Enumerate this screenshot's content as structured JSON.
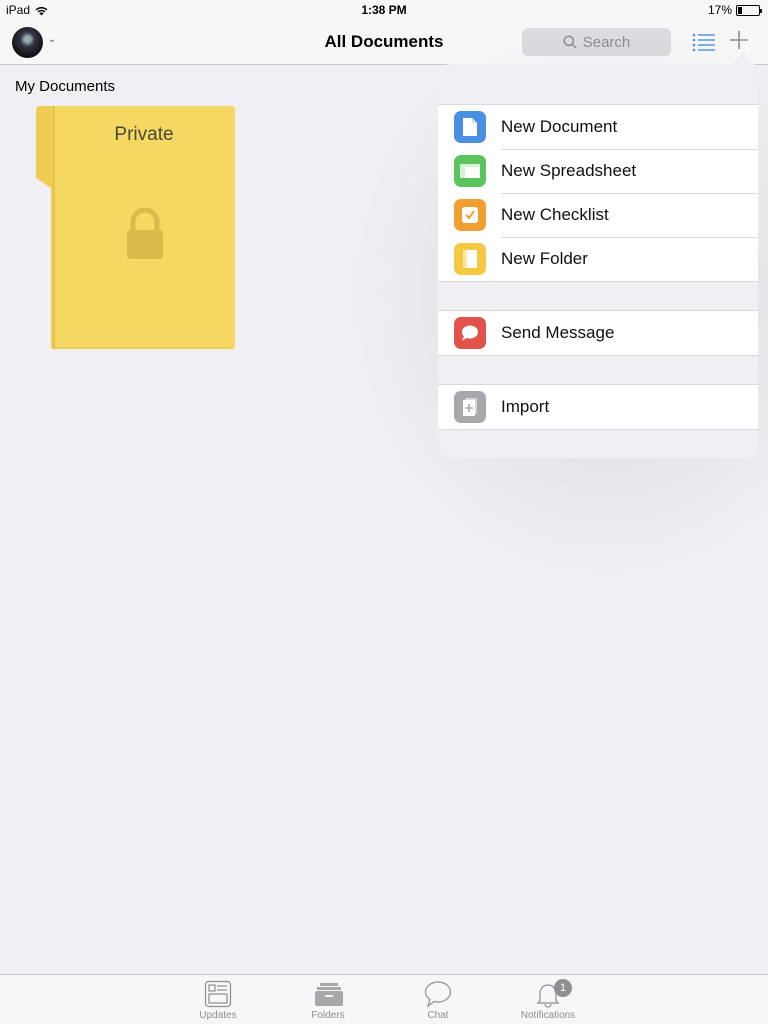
{
  "status": {
    "device": "iPad",
    "time": "1:38 PM",
    "battery": "17%",
    "battery_level": 0.17
  },
  "nav": {
    "title": "All Documents",
    "search_placeholder": "Search"
  },
  "content": {
    "section_title": "My Documents",
    "folder_name": "Private"
  },
  "menu": {
    "group1": [
      {
        "label": "New Document",
        "icon": "document-icon",
        "color": "#4a90e2"
      },
      {
        "label": "New Spreadsheet",
        "icon": "spreadsheet-icon",
        "color": "#5cc45c"
      },
      {
        "label": "New Checklist",
        "icon": "checklist-icon",
        "color": "#f0a030"
      },
      {
        "label": "New Folder",
        "icon": "folder-icon",
        "color": "#f5c842"
      }
    ],
    "group2": [
      {
        "label": "Send Message",
        "icon": "message-icon",
        "color": "#e0524a"
      }
    ],
    "group3": [
      {
        "label": "Import",
        "icon": "import-icon",
        "color": "#a8a8ac"
      }
    ]
  },
  "tabs": [
    {
      "label": "Updates",
      "icon": "updates-icon"
    },
    {
      "label": "Folders",
      "icon": "folders-icon"
    },
    {
      "label": "Chat",
      "icon": "chat-icon"
    },
    {
      "label": "Notifications",
      "icon": "bell-icon",
      "badge": "1"
    }
  ]
}
